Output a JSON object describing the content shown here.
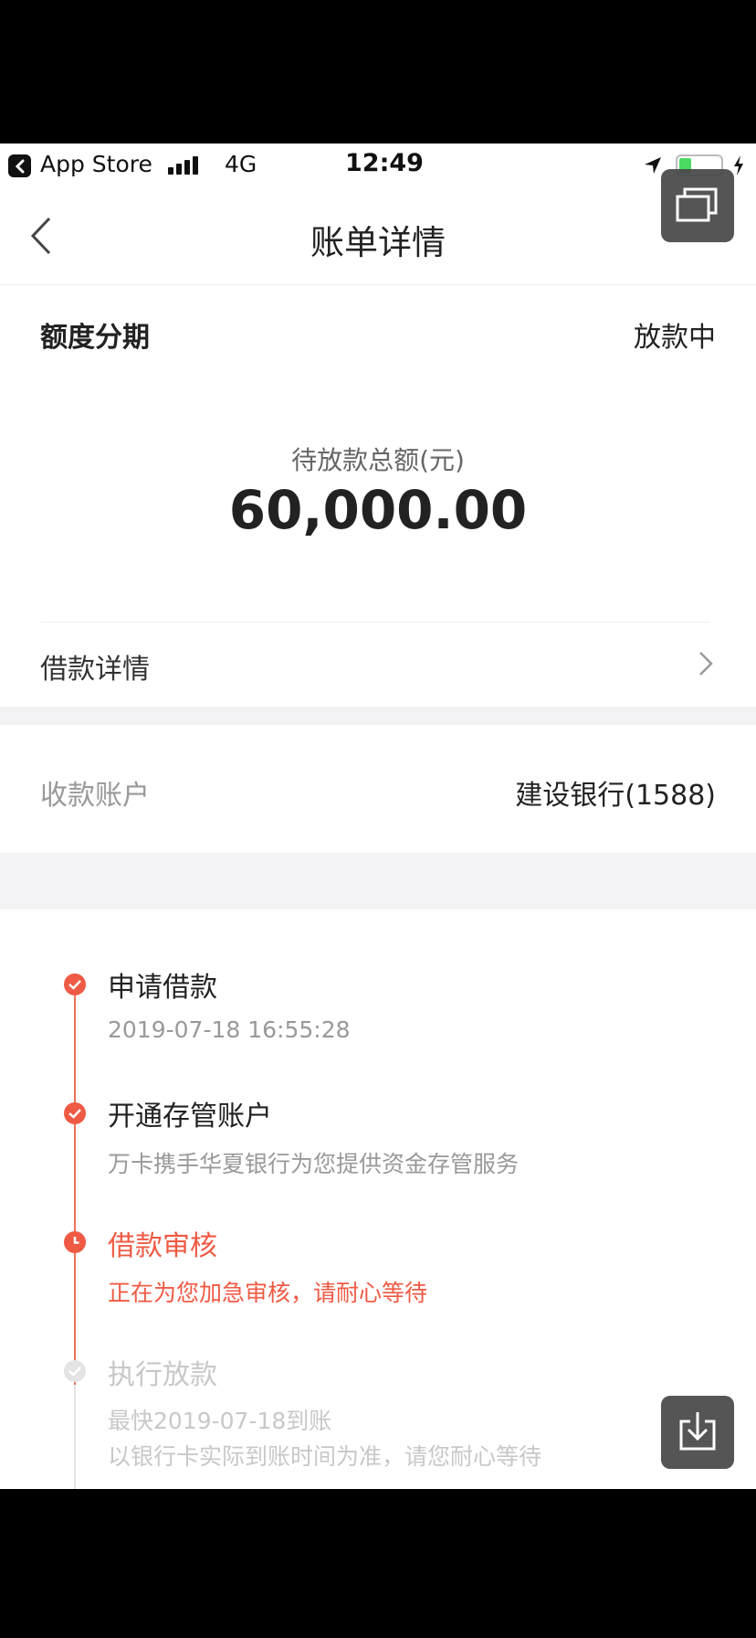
{
  "status_bar": {
    "app_back_label": "App Store",
    "network": "4G",
    "time": "12:49",
    "battery_level": 0.3
  },
  "header": {
    "title": "账单详情"
  },
  "summary": {
    "plan_label": "额度分期",
    "plan_status": "放款中",
    "amount_label": "待放款总额(元)",
    "amount_value": "60,000.00"
  },
  "loan_detail": {
    "label": "借款详情"
  },
  "account": {
    "label": "收款账户",
    "value": "建设银行(1588)"
  },
  "timeline": [
    {
      "title": "申请借款",
      "sub": "2019-07-18 16:55:28",
      "state": "done"
    },
    {
      "title": "开通存管账户",
      "sub": "万卡携手华夏银行为您提供资金存管服务",
      "state": "done"
    },
    {
      "title": "借款审核",
      "sub": "正在为您加急审核，请耐心等待",
      "state": "active"
    },
    {
      "title": "执行放款",
      "sub": "最快2019-07-18到账",
      "sub2": "以银行卡实际到账时间为准，请您耐心等待",
      "state": "pending"
    }
  ],
  "colors": {
    "accent": "#ef5a44",
    "muted": "#999999",
    "pending": "#c8c8c8"
  }
}
